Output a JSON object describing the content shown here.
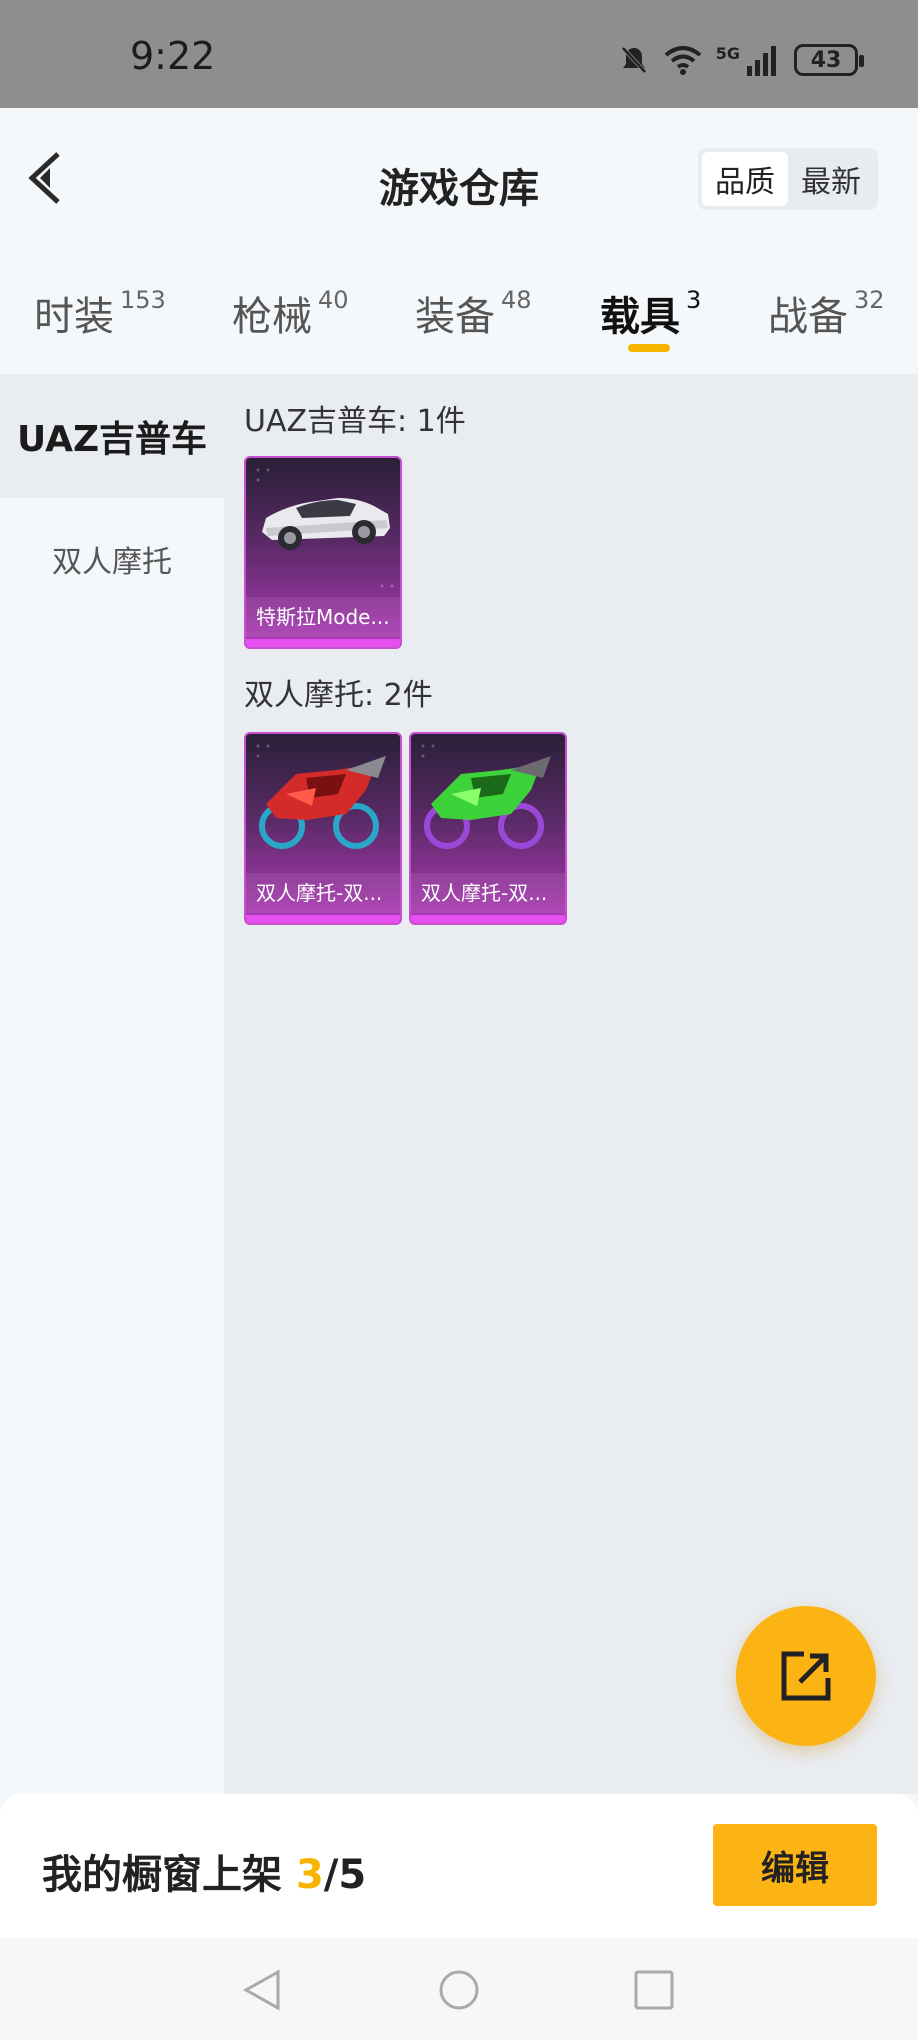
{
  "status_bar": {
    "time": "9:22",
    "network": "5G",
    "battery": "43"
  },
  "header": {
    "title": "游戏仓库",
    "sort_options": [
      "品质",
      "最新"
    ],
    "active_sort": "品质"
  },
  "tabs": [
    {
      "label": "时装",
      "count": "153"
    },
    {
      "label": "枪械",
      "count": "40"
    },
    {
      "label": "装备",
      "count": "48"
    },
    {
      "label": "载具",
      "count": "3"
    },
    {
      "label": "战备",
      "count": "32"
    }
  ],
  "active_tab": "载具",
  "sidebar": {
    "items": [
      "UAZ吉普车",
      "双人摩托"
    ],
    "active": "UAZ吉普车"
  },
  "groups": [
    {
      "title": "UAZ吉普车: 1件",
      "items": [
        {
          "name": "特斯拉Mode...",
          "icon": "white-car"
        }
      ]
    },
    {
      "title": "双人摩托: 2件",
      "items": [
        {
          "name": "双人摩托-双...",
          "icon": "red-motorcycle"
        },
        {
          "name": "双人摩托-双...",
          "icon": "green-motorcycle"
        }
      ]
    }
  ],
  "bottom": {
    "label": "我的橱窗上架 ",
    "current": "3",
    "total": "/5",
    "edit_label": "编辑"
  },
  "colors": {
    "accent": "#f7b500",
    "card_purple": "#b03ab8"
  }
}
